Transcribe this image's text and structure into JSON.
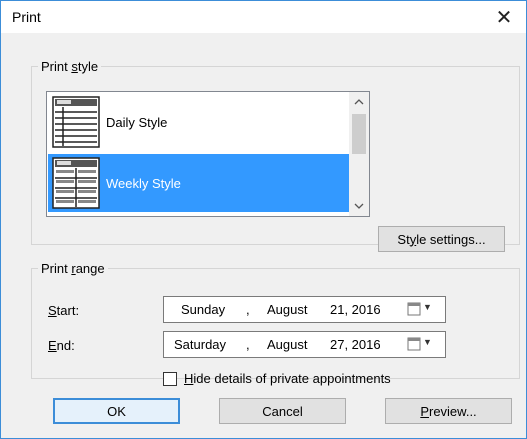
{
  "window": {
    "title": "Print",
    "close_glyph": "✕"
  },
  "print_style": {
    "group_label_pre": "Print ",
    "group_label_u": "s",
    "group_label_post": "tyle",
    "items": [
      {
        "label": "Daily Style",
        "selected": false,
        "icon": "daily-style-icon"
      },
      {
        "label": "Weekly Style",
        "selected": true,
        "icon": "weekly-style-icon"
      }
    ],
    "style_settings_pre": "St",
    "style_settings_u": "y",
    "style_settings_post": "le settings..."
  },
  "print_range": {
    "group_label_pre": "Print ",
    "group_label_u": "r",
    "group_label_post": "ange",
    "start": {
      "label_u": "S",
      "label_post": "tart:",
      "weekday": "Sunday",
      "month": "August",
      "day_year": "21, 2016"
    },
    "end": {
      "label_u": "E",
      "label_post": "nd:",
      "weekday": "Saturday",
      "month": "August",
      "day_year": "27, 2016"
    },
    "comma": ",",
    "hide_details_u": "H",
    "hide_details_post": "ide details of private appointments",
    "hide_details_checked": false
  },
  "buttons": {
    "ok": "OK",
    "cancel": "Cancel",
    "preview_u": "P",
    "preview_post": "review..."
  },
  "colors": {
    "selection": "#3399ff",
    "accent_border": "#3c8dd8",
    "dialog_bg": "#f0f0f0"
  }
}
